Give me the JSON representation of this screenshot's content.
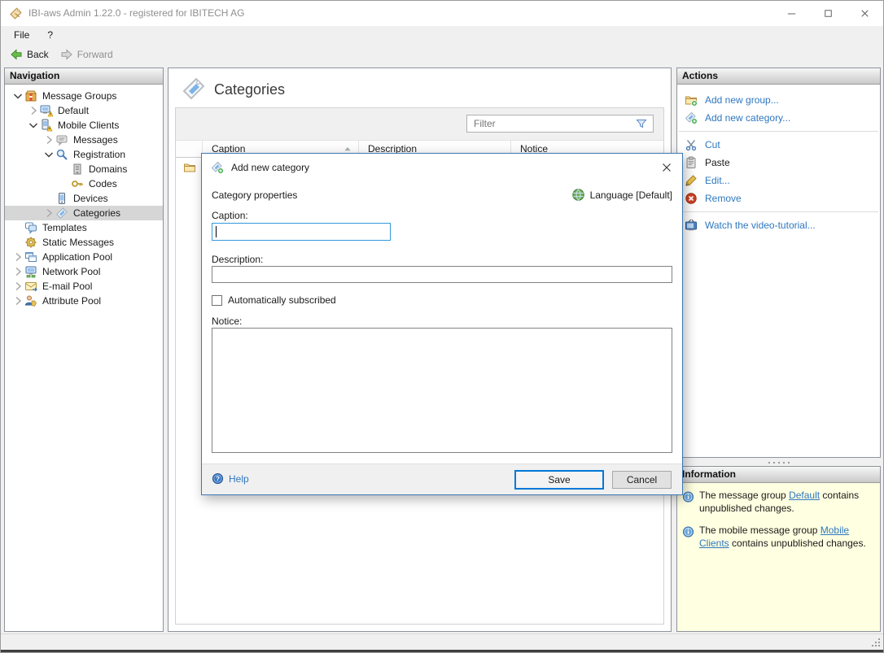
{
  "window": {
    "title": "IBI-aws Admin 1.22.0 - registered for IBITECH AG"
  },
  "menu": {
    "items": [
      {
        "label": "File",
        "name": "file"
      },
      {
        "label": "?",
        "name": "help"
      }
    ]
  },
  "toolbar": {
    "back_label": "Back",
    "forward_label": "Forward"
  },
  "navigation": {
    "header": "Navigation",
    "tree": [
      {
        "label": "Message Groups",
        "level": 0,
        "chevron": "expanded",
        "icon": "message-groups-icon"
      },
      {
        "label": "Default",
        "level": 1,
        "chevron": "collapsed",
        "icon": "default-group-icon"
      },
      {
        "label": "Mobile Clients",
        "level": 1,
        "chevron": "expanded",
        "icon": "mobile-clients-icon"
      },
      {
        "label": "Messages",
        "level": 2,
        "chevron": "collapsed",
        "icon": "messages-icon"
      },
      {
        "label": "Registration",
        "level": 2,
        "chevron": "expanded",
        "icon": "registration-icon"
      },
      {
        "label": "Domains",
        "level": 3,
        "chevron": "none",
        "icon": "domains-icon"
      },
      {
        "label": "Codes",
        "level": 3,
        "chevron": "none",
        "icon": "codes-icon"
      },
      {
        "label": "Devices",
        "level": 2,
        "chevron": "none",
        "icon": "devices-icon"
      },
      {
        "label": "Categories",
        "level": 2,
        "chevron": "collapsed",
        "icon": "categories-icon",
        "selected": true
      },
      {
        "label": "Templates",
        "level": 0,
        "chevron": "none",
        "icon": "templates-icon"
      },
      {
        "label": "Static Messages",
        "level": 0,
        "chevron": "none",
        "icon": "static-messages-icon"
      },
      {
        "label": "Application Pool",
        "level": 0,
        "chevron": "collapsed",
        "icon": "application-pool-icon"
      },
      {
        "label": "Network Pool",
        "level": 0,
        "chevron": "collapsed",
        "icon": "network-pool-icon"
      },
      {
        "label": "E-mail Pool",
        "level": 0,
        "chevron": "collapsed",
        "icon": "email-pool-icon"
      },
      {
        "label": "Attribute Pool",
        "level": 0,
        "chevron": "collapsed",
        "icon": "attribute-pool-icon"
      }
    ]
  },
  "main": {
    "title": "Categories",
    "title_icon": "tag-large-icon",
    "filter_placeholder": "Filter",
    "table": {
      "columns": [
        {
          "label": "",
          "name": "selector"
        },
        {
          "label": "Caption",
          "name": "caption",
          "sort": "asc"
        },
        {
          "label": "Description",
          "name": "description"
        },
        {
          "label": "Notice",
          "name": "notice"
        }
      ],
      "rows": [
        {
          "selector_icon": "folder-icon",
          "caption": "",
          "description": "",
          "notice": ""
        }
      ]
    }
  },
  "actions": {
    "header": "Actions",
    "items": [
      {
        "label": "Add new group...",
        "icon": "folder-add-icon"
      },
      {
        "label": "Add new category...",
        "icon": "tag-add-icon",
        "separator_after": true
      },
      {
        "label": "Cut",
        "icon": "scissors-icon"
      },
      {
        "label": "Paste",
        "icon": "clipboard-icon",
        "disabled": true
      },
      {
        "label": "Edit...",
        "icon": "pencil-icon"
      },
      {
        "label": "Remove",
        "icon": "remove-icon",
        "separator_after": true
      },
      {
        "label": "Watch the video-tutorial...",
        "icon": "tv-icon"
      }
    ]
  },
  "information": {
    "header": "Information",
    "items": [
      {
        "prefix": "The message group ",
        "link": "Default",
        "suffix": " contains unpublished changes."
      },
      {
        "prefix": "The mobile message group ",
        "link": "Mobile Clients",
        "suffix": " contains unpublished changes."
      }
    ]
  },
  "dialog": {
    "title": "Add new category",
    "title_icon": "tag-add-icon",
    "section_label": "Category properties",
    "language_label": "Language [Default]",
    "caption_label": "Caption:",
    "caption_value": "",
    "description_label": "Description:",
    "description_value": "",
    "checkbox_label": "Automatically subscribed",
    "checkbox_checked": false,
    "notice_label": "Notice:",
    "notice_value": "",
    "help_label": "Help",
    "save_label": "Save",
    "cancel_label": "Cancel"
  },
  "colors": {
    "link_blue": "#2e77c0",
    "info_background": "#ffffe1",
    "dialog_border": "#3c78b4",
    "focused_input_border": "#3399df",
    "default_button_border": "#0078d7",
    "selected_tree_row": "#d6d6d6"
  }
}
